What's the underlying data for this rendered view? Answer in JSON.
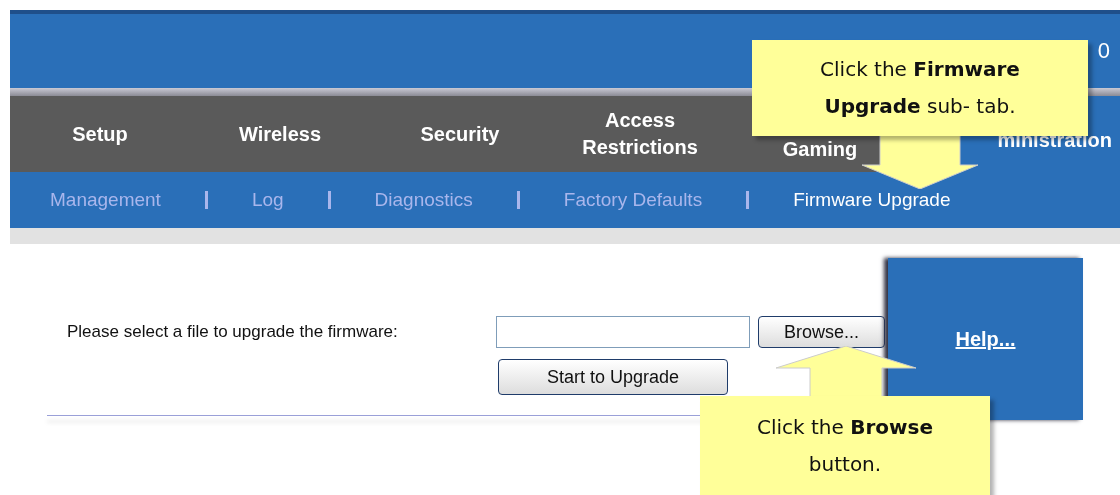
{
  "header": {
    "text": "0"
  },
  "tabs": [
    {
      "label": "Setup",
      "selected": false
    },
    {
      "label": "Wireless",
      "selected": false
    },
    {
      "label": "Security",
      "selected": false
    },
    {
      "label": "Access Restrictions",
      "selected": false
    },
    {
      "label": "Gaming",
      "selected": false
    },
    {
      "label": "ministration",
      "selected": true
    }
  ],
  "subtabs": [
    {
      "label": "Management",
      "selected": false
    },
    {
      "label": "Log",
      "selected": false
    },
    {
      "label": "Diagnostics",
      "selected": false
    },
    {
      "label": "Factory Defaults",
      "selected": false
    },
    {
      "label": "Firmware Upgrade",
      "selected": true
    }
  ],
  "form": {
    "label": "Please select a file to upgrade the firmware:",
    "browse_button": "Browse...",
    "upgrade_button": "Start to Upgrade"
  },
  "help": {
    "link": "Help..."
  },
  "callouts": [
    {
      "text": "Click the **Firmware Upgrade** sub- tab.",
      "kind": "arrow-down"
    },
    {
      "text": "Click the **Browse** button.",
      "kind": "arrow-up"
    }
  ]
}
